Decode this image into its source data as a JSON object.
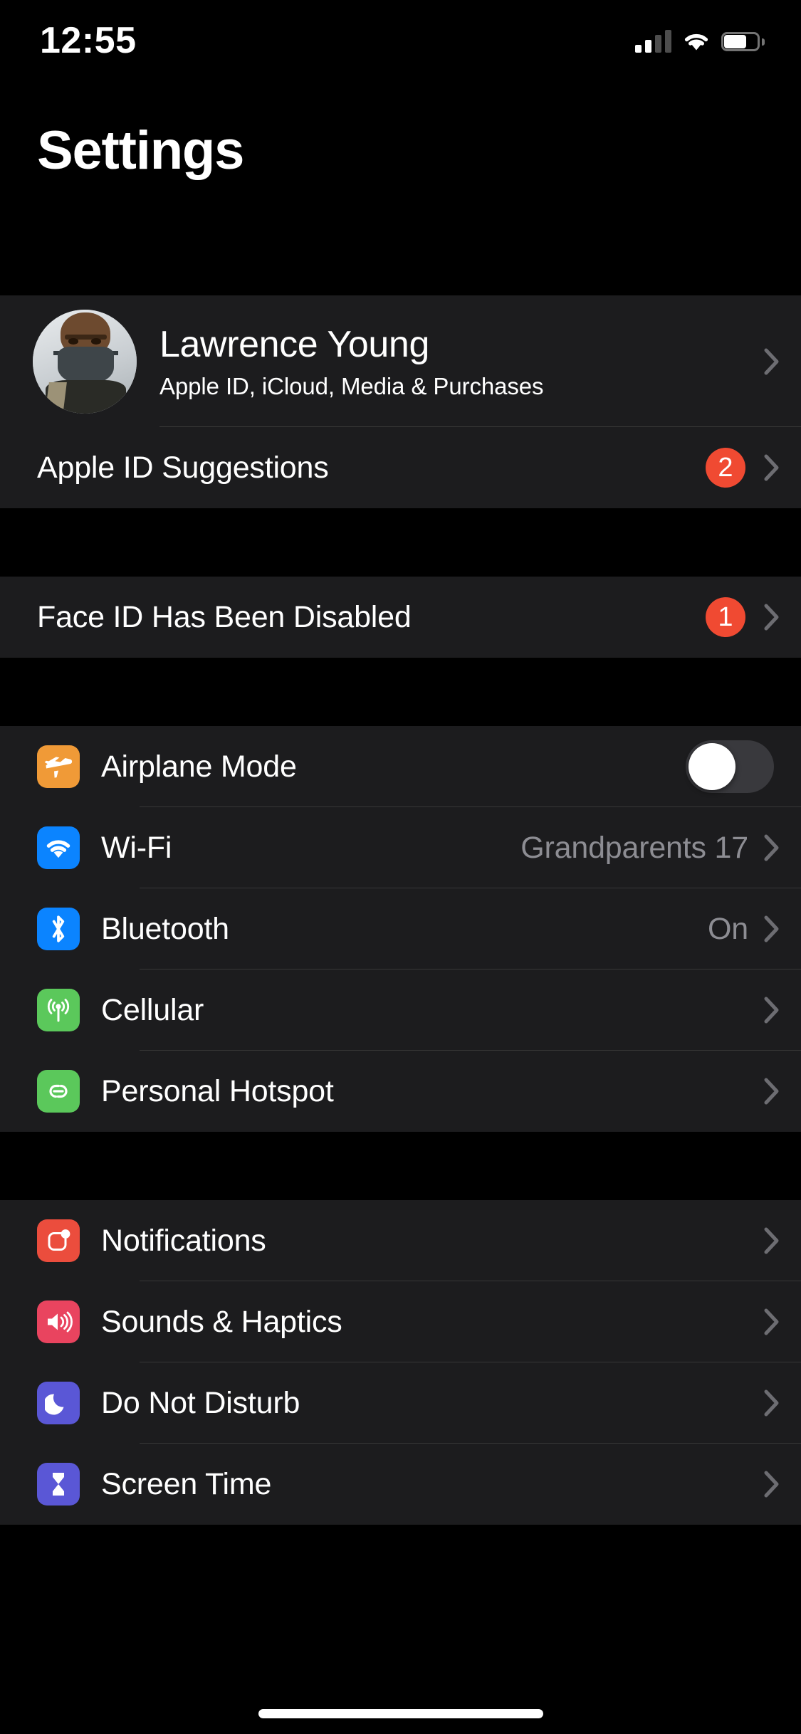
{
  "status_bar": {
    "time": "12:55",
    "cellular_icon": "cellular-signal-icon",
    "cellular_bars_filled": 2,
    "cellular_bars_total": 4,
    "wifi_icon": "wifi-icon",
    "battery_icon": "battery-icon",
    "battery_percent": 58
  },
  "header": {
    "title": "Settings"
  },
  "account_section": {
    "profile": {
      "avatar": "user-avatar",
      "name": "Lawrence Young",
      "subtitle": "Apple ID, iCloud, Media & Purchases",
      "chevron": "chevron-right-icon"
    },
    "suggestions": {
      "label": "Apple ID Suggestions",
      "badge": "2",
      "chevron": "chevron-right-icon"
    }
  },
  "alert_section": {
    "face_id": {
      "label": "Face ID Has Been Disabled",
      "badge": "1",
      "chevron": "chevron-right-icon"
    }
  },
  "connectivity_section": {
    "rows": [
      {
        "label": "Airplane Mode",
        "icon": "airplane-icon",
        "icon_color": "#F09A37",
        "control": "toggle",
        "toggle_on": false
      },
      {
        "label": "Wi-Fi",
        "icon": "wifi-icon",
        "icon_color": "#0B84FF",
        "value": "Grandparents 17",
        "control": "chevron"
      },
      {
        "label": "Bluetooth",
        "icon": "bluetooth-icon",
        "icon_color": "#0B84FF",
        "value": "On",
        "control": "chevron"
      },
      {
        "label": "Cellular",
        "icon": "cellular-antenna-icon",
        "icon_color": "#5BC85B",
        "value": "",
        "control": "chevron"
      },
      {
        "label": "Personal Hotspot",
        "icon": "personal-hotspot-icon",
        "icon_color": "#5BC85B",
        "value": "",
        "control": "chevron"
      }
    ]
  },
  "system_section": {
    "rows": [
      {
        "label": "Notifications",
        "icon": "notifications-icon",
        "icon_color": "#EB4D3D",
        "control": "chevron"
      },
      {
        "label": "Sounds & Haptics",
        "icon": "sounds-haptics-icon",
        "icon_color": "#E9445F",
        "control": "chevron"
      },
      {
        "label": "Do Not Disturb",
        "icon": "do-not-disturb-moon-icon",
        "icon_color": "#5A57D6",
        "control": "chevron"
      },
      {
        "label": "Screen Time",
        "icon": "screen-time-hourglass-icon",
        "icon_color": "#5A57D6",
        "control": "chevron"
      }
    ]
  },
  "home_indicator": "home-indicator"
}
